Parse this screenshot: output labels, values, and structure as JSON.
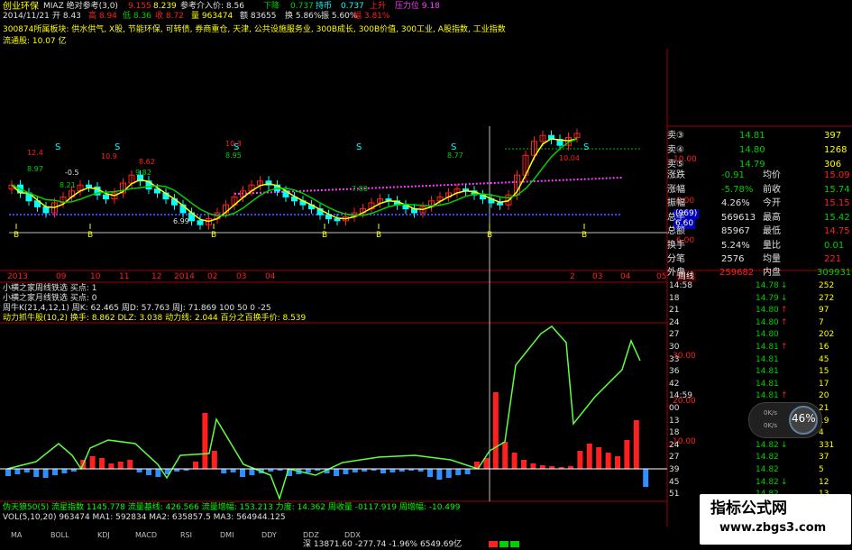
{
  "header": {
    "line1": [
      "创业环保",
      "MIAZ 绝对参考(3,0)",
      "9.155",
      "8.239",
      "参考介入价: 8.56",
      "下降",
      "0.737",
      "持币",
      "0.737",
      "上升",
      "压力位 9.18"
    ],
    "line2": [
      "2014/11/21",
      "开 8.43",
      "高 8.94",
      "低 8.36",
      "收 8.72",
      "量 963474",
      "额 83655",
      "换 5.86%",
      "振 5.60%",
      "幅 3.81%"
    ],
    "sectors": [
      "300874所属板块:",
      "供水供气,",
      "X股,",
      "节能环保,",
      "可转债,",
      "券商重仓,",
      "天津,",
      "公共设施服务业,",
      "300B成长,",
      "300B价值,",
      "300工业,",
      "A股指数,",
      "工业指数"
    ],
    "float_cap": "流通股: 10.07 亿"
  },
  "price_panel": {
    "price_labels": [
      "11.00",
      "10.00",
      "8.00",
      "7.00",
      "6.00"
    ],
    "annotations": [
      "12.4",
      "8.97",
      "-0.5",
      "8.21",
      "10.9",
      "9.82",
      "10.3",
      "8.95",
      "S",
      "8.62",
      "-0.4",
      "7.80",
      "10.0",
      "8.77",
      "6.99",
      "7.43",
      "10.04",
      "11.53",
      "10.58"
    ],
    "box_labels": [
      "(969)",
      "6.60"
    ],
    "buy_marks": [
      "B",
      "B",
      "B",
      "B",
      "B",
      "B",
      "B",
      "B"
    ],
    "sell_marks": [
      "S",
      "S",
      "S",
      "S",
      "S",
      "S",
      "S"
    ]
  },
  "time_axis": {
    "labels": [
      "2013",
      "09",
      "10",
      "11",
      "12",
      "2014",
      "02",
      "03",
      "04",
      "05",
      "06",
      "07",
      "08",
      "09",
      "10",
      "11",
      "2",
      "03",
      "04",
      "05",
      "周线"
    ]
  },
  "indicator_lines": {
    "line1": "小横之家周线铁选  买点: 1",
    "line2": "小横之家月线铁选  买点: 0",
    "line3": "周牛K(21,4,12,1)  周K: 62.465  周D: 57.763  周J: 71.869  100  50  0  -25",
    "line4": "动力抓牛股(10,2)  换手: 8.862  DLZ: 3.038  动力线: 2.044  百分之百换手价: 8.539"
  },
  "lower_panel": {
    "price_labels": [
      "30.00",
      "20.00",
      "10.00"
    ],
    "line1": "伪天狼50(5)  流星指数 1145.778  流量基线: 426.566  流量增幅: 153.213  力度: 14.362  周收量 -0117.919  周增幅: -10.499",
    "line2": "VOL(5,10,20)  963474  MA1: 592834  MA2: 635857.5  MA3: 564944.125"
  },
  "quote": {
    "asks": [
      {
        "label": "卖③",
        "price": "14.81",
        "vol": "397"
      },
      {
        "label": "卖④",
        "price": "14.80",
        "vol": "1268"
      },
      {
        "label": "卖⑤",
        "price": "14.79",
        "vol": "306"
      }
    ],
    "stats": [
      {
        "k1": "涨跌",
        "v1": "-0.91",
        "k2": "均价",
        "v2": "15.09"
      },
      {
        "k1": "涨幅",
        "v1": "-5.78%",
        "k2": "前收",
        "v2": "15.74"
      },
      {
        "k1": "振幅",
        "v1": "4.26%",
        "k2": "今开",
        "v2": "15.15"
      },
      {
        "k1": "总手",
        "v1": "569613",
        "k2": "最高",
        "v2": "15.42"
      },
      {
        "k1": "总额",
        "v1": "85967",
        "k2": "最低",
        "v2": "14.75"
      },
      {
        "k1": "换手",
        "v1": "5.24%",
        "k2": "量比",
        "v2": "0.01"
      },
      {
        "k1": "分笔",
        "v1": "2576",
        "k2": "均量",
        "v2": "221"
      }
    ],
    "outer": {
      "k1": "外盘",
      "v1": "259682",
      "k2": "内盘",
      "v2": "309931"
    }
  },
  "ticks": [
    {
      "t": "14:58",
      "p": "14.78",
      "d": "↓",
      "v": "252"
    },
    {
      "t": "18",
      "p": "14.79",
      "d": "↓",
      "v": "272"
    },
    {
      "t": "21",
      "p": "14.80",
      "d": "↑",
      "v": "97"
    },
    {
      "t": "24",
      "p": "14.80",
      "d": "↑",
      "v": "7"
    },
    {
      "t": "27",
      "p": "14.80",
      "d": "",
      "v": "202"
    },
    {
      "t": "30",
      "p": "14.81",
      "d": "↑",
      "v": "16"
    },
    {
      "t": "33",
      "p": "14.81",
      "d": "",
      "v": "45"
    },
    {
      "t": "36",
      "p": "14.81",
      "d": "",
      "v": "15"
    },
    {
      "t": "42",
      "p": "14.81",
      "d": "",
      "v": "17"
    },
    {
      "t": "14:59",
      "p": "14.81",
      "d": "↑",
      "v": "20"
    },
    {
      "t": "00",
      "p": "14.80",
      "d": "",
      "v": "21"
    },
    {
      "t": "13",
      "p": "14.81",
      "d": "",
      "v": "19"
    },
    {
      "t": "18",
      "p": "14.82",
      "d": "",
      "v": "4"
    },
    {
      "t": "24",
      "p": "14.82",
      "d": "↓",
      "v": "331"
    },
    {
      "t": "27",
      "p": "14.82",
      "d": "",
      "v": "37"
    },
    {
      "t": "39",
      "p": "14.82",
      "d": "",
      "v": "5"
    },
    {
      "t": "45",
      "p": "14.82",
      "d": "↓",
      "v": "12"
    },
    {
      "t": "51",
      "p": "14.82",
      "d": "",
      "v": "13"
    }
  ],
  "speed_gauge": {
    "percent": "46%",
    "up": "0K/s",
    "down": "0K/s"
  },
  "tabs": [
    "MA",
    "BOLL",
    "KDJ",
    "MACD",
    "RSI",
    "DMI",
    "DDY",
    "DDZ",
    "DDX"
  ],
  "status_bar": "深 13871.60 -277.74 -1.96% 6549.69亿",
  "watermark": {
    "title": "指标公式网",
    "url": "www.zbgs3.com"
  },
  "colors": {
    "up": "#ff2020",
    "down": "#00ffff",
    "green": "#00d000",
    "yellow": "#ffff00",
    "magenta": "#ff40ff",
    "white": "#e0e0e0",
    "axis": "#a00000"
  }
}
